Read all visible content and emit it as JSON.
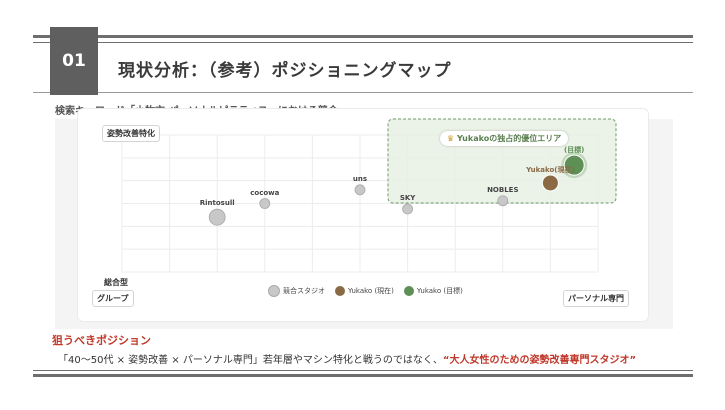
{
  "header": {
    "number": "01",
    "title": "現状分析：（参考）ポジショニングマップ"
  },
  "chart": {
    "subtitle": "検索キーワード「小牧市 パーソナルピラティス」における競合",
    "y_axis_top": "姿勢改善特化",
    "y_axis_bottom_1": "総合型",
    "y_axis_bottom_2": "グループ",
    "x_axis_right": "パーソナル専門",
    "zone_label": "Yukakoの独占的優位エリア",
    "zone_icon": "crown-icon",
    "legend": [
      {
        "label": "競合スタジオ",
        "color": "#c8c8c8"
      },
      {
        "label": "Yukako (現在)",
        "color": "#8a6a45"
      },
      {
        "label": "Yukako (目標)",
        "color": "#5e8f55"
      }
    ],
    "colors": {
      "competitor": "#c8c8c8",
      "current": "#8a6a45",
      "target": "#5e8f55",
      "zone": "#e8f0e4"
    }
  },
  "chart_data": {
    "type": "scatter",
    "xlabel": "パーソナル専門",
    "ylabel": "姿勢改善特化",
    "xlim": [
      0,
      10
    ],
    "ylim": [
      0,
      10
    ],
    "grid": true,
    "series": [
      {
        "name": "競合スタジオ",
        "points": [
          {
            "label": "Rintosull",
            "x": 2.0,
            "y": 4.0,
            "size": "large"
          },
          {
            "label": "cocowa",
            "x": 3.0,
            "y": 5.0,
            "size": "small"
          },
          {
            "label": "uns",
            "x": 5.0,
            "y": 6.0,
            "size": "small"
          },
          {
            "label": "SKY",
            "x": 6.0,
            "y": 4.6,
            "size": "small"
          },
          {
            "label": "NOBLES",
            "x": 8.0,
            "y": 5.2,
            "size": "small"
          }
        ]
      },
      {
        "name": "Yukako (現在)",
        "points": [
          {
            "label": "Yukako(現在)",
            "x": 9.0,
            "y": 6.5,
            "size": "large"
          }
        ]
      },
      {
        "name": "Yukako (目標)",
        "points": [
          {
            "label": "(目標)",
            "x": 9.5,
            "y": 7.8,
            "size": "large"
          }
        ]
      }
    ]
  },
  "target": {
    "heading": "狙うべきポジション",
    "text_before": "「40〜50代 × 姿勢改善 × パーソナル専門」若年層やマシン特化と戦うのではなく、",
    "text_highlight": "“大人女性のための姿勢改善専門スタジオ”"
  }
}
